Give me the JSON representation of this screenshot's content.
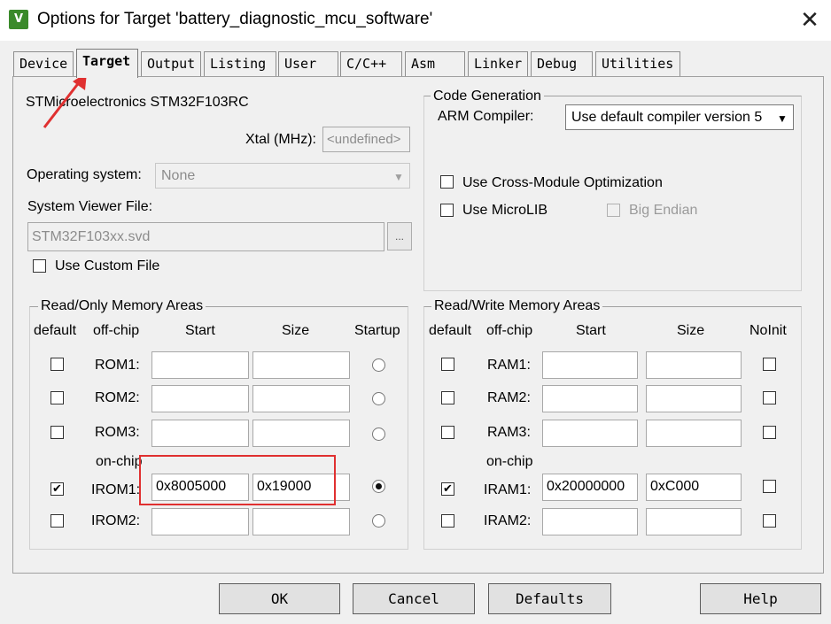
{
  "window": {
    "title": "Options for Target 'battery_diagnostic_mcu_software'",
    "icon": "keil-uvision-icon",
    "close": "✕"
  },
  "tabs": [
    {
      "label": "Device"
    },
    {
      "label": "Target"
    },
    {
      "label": "Output"
    },
    {
      "label": "Listing"
    },
    {
      "label": "User"
    },
    {
      "label": "C/C++"
    },
    {
      "label": "Asm"
    },
    {
      "label": "Linker"
    },
    {
      "label": "Debug"
    },
    {
      "label": "Utilities"
    }
  ],
  "active_tab": "Target",
  "device": {
    "name": "STMicroelectronics STM32F103RC",
    "xtal_label": "Xtal (MHz):",
    "xtal_value": "<undefined>",
    "os_label": "Operating system:",
    "os_value": "None",
    "svd_label": "System Viewer File:",
    "svd_value": "STM32F103xx.svd",
    "browse": "...",
    "custom_file": "Use Custom File"
  },
  "code_generation": {
    "title": "Code Generation",
    "compiler_label": "ARM Compiler:",
    "compiler_value": "Use default compiler version 5",
    "cross_module": "Use Cross-Module Optimization",
    "microlib": "Use MicroLIB",
    "big_endian": "Big Endian"
  },
  "ro_memory": {
    "title": "Read/Only Memory Areas",
    "headers": {
      "default": "default",
      "offchip": "off-chip",
      "start": "Start",
      "size": "Size",
      "startup": "Startup"
    },
    "onchip_label": "on-chip",
    "rows": [
      {
        "name": "ROM1:",
        "start": "",
        "size": "",
        "checked": false,
        "startup": false
      },
      {
        "name": "ROM2:",
        "start": "",
        "size": "",
        "checked": false,
        "startup": false
      },
      {
        "name": "ROM3:",
        "start": "",
        "size": "",
        "checked": false,
        "startup": false
      },
      {
        "name": "IROM1:",
        "start": "0x8005000",
        "size": "0x19000",
        "checked": true,
        "startup": true
      },
      {
        "name": "IROM2:",
        "start": "",
        "size": "",
        "checked": false,
        "startup": false
      }
    ]
  },
  "rw_memory": {
    "title": "Read/Write Memory Areas",
    "headers": {
      "default": "default",
      "offchip": "off-chip",
      "start": "Start",
      "size": "Size",
      "noinit": "NoInit"
    },
    "onchip_label": "on-chip",
    "rows": [
      {
        "name": "RAM1:",
        "start": "",
        "size": "",
        "checked": false,
        "noinit": false
      },
      {
        "name": "RAM2:",
        "start": "",
        "size": "",
        "checked": false,
        "noinit": false
      },
      {
        "name": "RAM3:",
        "start": "",
        "size": "",
        "checked": false,
        "noinit": false
      },
      {
        "name": "IRAM1:",
        "start": "0x20000000",
        "size": "0xC000",
        "checked": true,
        "noinit": false
      },
      {
        "name": "IRAM2:",
        "start": "",
        "size": "",
        "checked": false,
        "noinit": false
      }
    ]
  },
  "buttons": {
    "ok": "OK",
    "cancel": "Cancel",
    "defaults": "Defaults",
    "help": "Help"
  },
  "check_glyph": "✔",
  "colors": {
    "annotation": "#e03030"
  }
}
